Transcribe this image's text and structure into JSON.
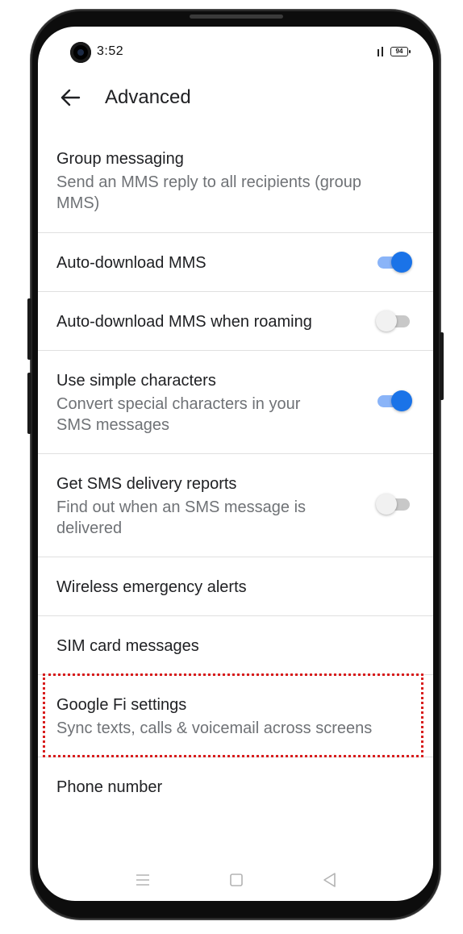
{
  "status_bar": {
    "time": "3:52",
    "battery": "94",
    "icons": [
      "signal-icon",
      "battery-icon"
    ]
  },
  "app_bar": {
    "title": "Advanced",
    "back_icon": "arrow-left-icon"
  },
  "settings": [
    {
      "title": "Group messaging",
      "subtitle": "Send an MMS reply to all recipients (group MMS)"
    },
    {
      "title": "Auto-download MMS",
      "toggle": true
    },
    {
      "title": "Auto-download MMS when roaming",
      "toggle": false
    },
    {
      "title": "Use simple characters",
      "subtitle": "Convert special characters in your SMS messages",
      "toggle": true
    },
    {
      "title": "Get SMS delivery reports",
      "subtitle": "Find out when an SMS message is delivered",
      "toggle": false
    },
    {
      "title": "Wireless emergency alerts"
    },
    {
      "title": "SIM card messages"
    },
    {
      "title": "Google Fi settings",
      "subtitle": "Sync texts, calls & voicemail across screens",
      "highlighted": true
    },
    {
      "title": "Phone number"
    }
  ],
  "nav_bar": {
    "icons": [
      "menu-icon",
      "home-icon",
      "back-triangle-icon"
    ]
  },
  "colors": {
    "accent": "#1a73e8",
    "accent_track": "#8ab4f8",
    "highlight": "#d81e1e"
  }
}
